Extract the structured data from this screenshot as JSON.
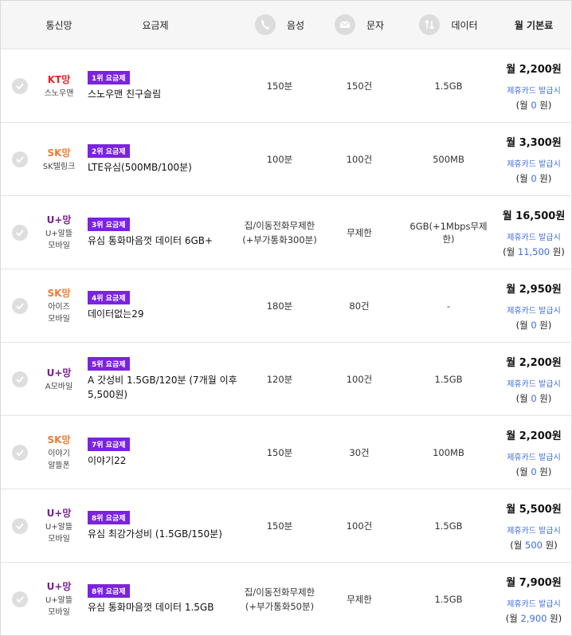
{
  "headers": {
    "carrier": "통신망",
    "plan": "요금제",
    "voice": "음성",
    "sms": "문자",
    "data": "데이터",
    "fee": "월 기본료"
  },
  "colors": {
    "KT": "#e0232f",
    "SK": "#f07b32",
    "U+": "#7b1f8f",
    "badge": "#7b23e0",
    "link": "#3d6ce0"
  },
  "rows": [
    {
      "carrier": "KT망",
      "carrier_key": "KT",
      "brand_lines": [
        "스노우맨"
      ],
      "rank": "1위 요금제",
      "plan_lines": [
        "스노우맨 친구슬림"
      ],
      "voice_lines": [
        "150분"
      ],
      "sms": "150건",
      "data": "1.5GB",
      "price": "월 2,200원",
      "card": "제휴카드 발급시",
      "disc_pre": "(월 ",
      "disc_amt": "0",
      "disc_post": " 원)"
    },
    {
      "carrier": "SK망",
      "carrier_key": "SK",
      "brand_lines": [
        "SK텔링크"
      ],
      "rank": "2위 요금제",
      "plan_lines": [
        "LTE유심(500MB/100분)"
      ],
      "voice_lines": [
        "100분"
      ],
      "sms": "100건",
      "data": "500MB",
      "price": "월 3,300원",
      "card": "제휴카드 발급시",
      "disc_pre": "(월 ",
      "disc_amt": "0",
      "disc_post": " 원)"
    },
    {
      "carrier": "U+망",
      "carrier_key": "U+",
      "brand_lines": [
        "U+알뜰",
        "모바일"
      ],
      "rank": "3위 요금제",
      "plan_lines": [
        "유심 통화마음껏 데이터 6GB+"
      ],
      "voice_lines": [
        "집/이동전화무제한",
        "(+부가통화300분)"
      ],
      "sms": "무제한",
      "data": "6GB(+1Mbps무제한)",
      "price": "월 16,500원",
      "card": "제휴카드 발급시",
      "disc_pre": "(월 ",
      "disc_amt": "11,500",
      "disc_post": " 원)"
    },
    {
      "carrier": "SK망",
      "carrier_key": "SK",
      "brand_lines": [
        "아이즈",
        "모바일"
      ],
      "rank": "4위 요금제",
      "plan_lines": [
        "데이터없는29"
      ],
      "voice_lines": [
        "180분"
      ],
      "sms": "80건",
      "data": "-",
      "price": "월 2,950원",
      "card": "제휴카드 발급시",
      "disc_pre": "(월 ",
      "disc_amt": "0",
      "disc_post": " 원)"
    },
    {
      "carrier": "U+망",
      "carrier_key": "U+",
      "brand_lines": [
        "A모바일"
      ],
      "rank": "5위 요금제",
      "plan_lines": [
        "A 갓성비 1.5GB/120분 (7개월 이후",
        "5,500원)"
      ],
      "voice_lines": [
        "120분"
      ],
      "sms": "100건",
      "data": "1.5GB",
      "price": "월 2,200원",
      "card": "제휴카드 발급시",
      "disc_pre": "(월 ",
      "disc_amt": "0",
      "disc_post": " 원)"
    },
    {
      "carrier": "SK망",
      "carrier_key": "SK",
      "brand_lines": [
        "이야기",
        "알뜰폰"
      ],
      "rank": "7위 요금제",
      "plan_lines": [
        "이야기22"
      ],
      "voice_lines": [
        "150분"
      ],
      "sms": "30건",
      "data": "100MB",
      "price": "월 2,200원",
      "card": "제휴카드 발급시",
      "disc_pre": "(월 ",
      "disc_amt": "0",
      "disc_post": " 원)"
    },
    {
      "carrier": "U+망",
      "carrier_key": "U+",
      "brand_lines": [
        "U+알뜰",
        "모바일"
      ],
      "rank": "8위 요금제",
      "plan_lines": [
        "유심 최강가성비 (1.5GB/150분)"
      ],
      "voice_lines": [
        "150분"
      ],
      "sms": "100건",
      "data": "1.5GB",
      "price": "월 5,500원",
      "card": "제휴카드 발급시",
      "disc_pre": "(월 ",
      "disc_amt": "500",
      "disc_post": " 원)"
    },
    {
      "carrier": "U+망",
      "carrier_key": "U+",
      "brand_lines": [
        "U+알뜰",
        "모바일"
      ],
      "rank": "8위 요금제",
      "plan_lines": [
        "유심 통화마음껏 데이터 1.5GB"
      ],
      "voice_lines": [
        "집/이동전화무제한",
        "(+부가통화50분)"
      ],
      "sms": "무제한",
      "data": "1.5GB",
      "price": "월 7,900원",
      "card": "제휴카드 발급시",
      "disc_pre": "(월 ",
      "disc_amt": "2,900",
      "disc_post": " 원)"
    }
  ]
}
